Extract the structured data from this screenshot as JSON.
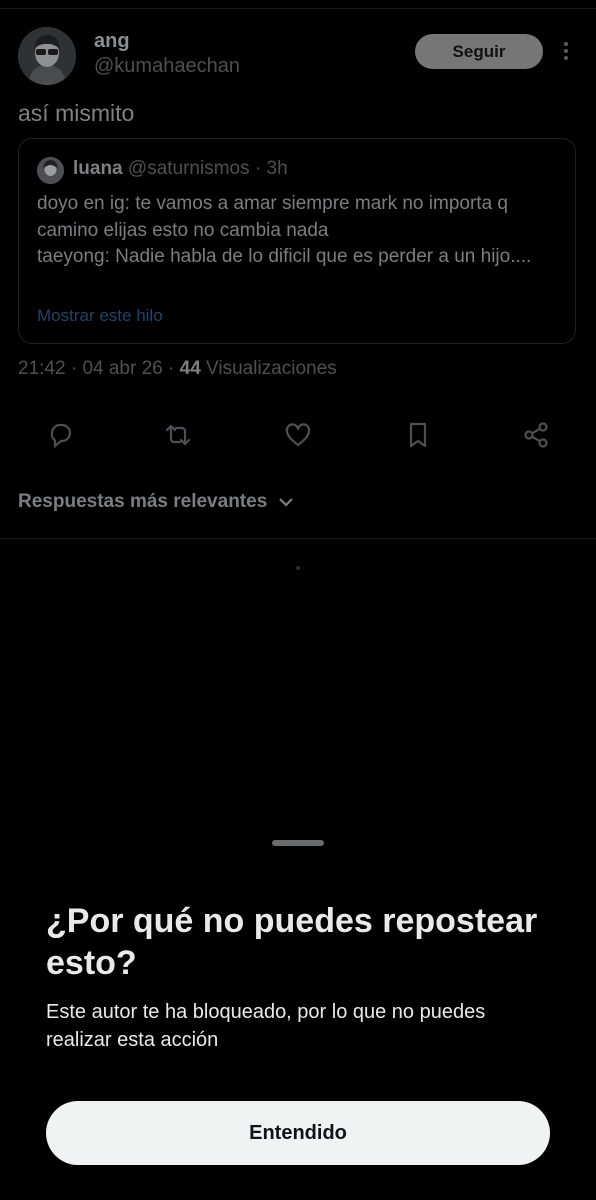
{
  "post": {
    "author_name": "ang",
    "author_handle": "@kumahaechan",
    "follow_label": "Seguir",
    "text": "así mismito",
    "time": "21:42",
    "sep1": "·",
    "date": "04 abr 26",
    "sep2": "·",
    "views_count": "44",
    "views_label": "Visualizaciones"
  },
  "quote": {
    "name": "luana",
    "handle": "@saturnismos",
    "time": "· 3h",
    "body": "doyo en ig: te vamos a amar siempre mark no importa q camino elijas esto no cambia nada\ntaeyong: Nadie habla de lo dificil que es perder a un hijo....",
    "show_thread": "Mostrar este hilo"
  },
  "actions": {
    "icons": [
      "reply-icon",
      "repost-icon",
      "like-icon",
      "bookmark-icon",
      "share-icon"
    ],
    "color": "#4c5054"
  },
  "replies_sort": {
    "label": "Respuestas más relevantes",
    "icon": "chevron-down-icon"
  },
  "sheet": {
    "title": "¿Por qué no puedes repostear esto?",
    "body": "Este autor te ha bloqueado, por lo que no puedes realizar esta acción",
    "button_label": "Entendido"
  },
  "colors": {
    "background": "#000000",
    "link": "#1d4569",
    "button_bg": "#eff3f4"
  }
}
